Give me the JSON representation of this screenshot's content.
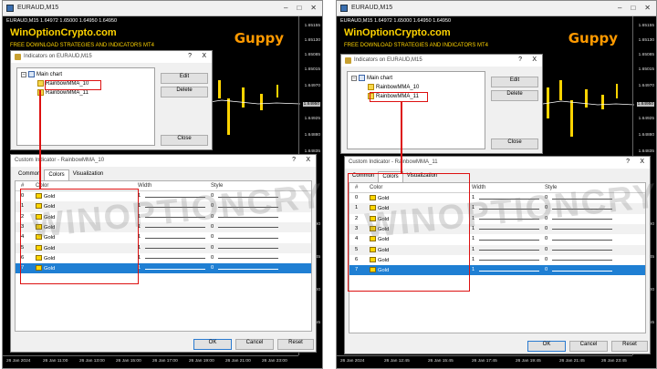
{
  "left": {
    "window_title": "EURAUD,M15",
    "symbol_line": "EURAUD,M15  1.64972  1.65000  1.64950  1.64950",
    "brand": "WinOptionCrypto.com",
    "subtitle": "FREE DOWNLOAD STRATEGIES AND INDICATORS MT4",
    "logo": "Guppy",
    "prices": [
      "1.65155",
      "1.65130",
      "1.65085",
      "1.65015",
      "1.64970",
      "1.64950",
      "1.64925",
      "1.64880",
      "1.64835",
      "1.64790",
      "1.64745",
      "1.64700",
      "1.64655"
    ],
    "times": [
      "26 Jan 2024",
      "26 Jan 11:00",
      "26 Jan 13:00",
      "26 Jan 15:00",
      "26 Jan 17:00",
      "26 Jan 19:00",
      "26 Jan 21:00",
      "26 Jan 23:00"
    ],
    "ind_dialog": {
      "title": "Indicators on EURAUD,M15",
      "help": "?",
      "close_x": "X",
      "main_chart": "Main chart",
      "items": [
        "RainbowMMA_10",
        "RainbowMMA_11"
      ],
      "edit": "Edit",
      "delete": "Delete",
      "close": "Close"
    },
    "custom_dialog": {
      "title": "Custom Indicator - RainbowMMA_10",
      "help": "?",
      "close_x": "X",
      "tabs": [
        "Common",
        "Colors",
        "Visualization"
      ],
      "columns": [
        "#",
        "Color",
        "Width",
        "Style"
      ],
      "rows": [
        {
          "n": "0",
          "color": "Gold",
          "width": "1",
          "style": "0"
        },
        {
          "n": "1",
          "color": "Gold",
          "width": "1",
          "style": "0"
        },
        {
          "n": "2",
          "color": "Gold",
          "width": "1",
          "style": "0"
        },
        {
          "n": "3",
          "color": "Gold",
          "width": "1",
          "style": "0"
        },
        {
          "n": "4",
          "color": "Gold",
          "width": "1",
          "style": "0"
        },
        {
          "n": "5",
          "color": "Gold",
          "width": "1",
          "style": "0"
        },
        {
          "n": "6",
          "color": "Gold",
          "width": "1",
          "style": "0"
        },
        {
          "n": "7",
          "color": "Gold",
          "width": "1",
          "style": "0"
        }
      ],
      "ok": "OK",
      "cancel": "Cancel",
      "reset": "Reset"
    }
  },
  "right": {
    "window_title": "EURAUD,M15",
    "symbol_line": "EURAUD,M15  1.64972  1.65000  1.64950  1.64950",
    "brand": "WinOptionCrypto.com",
    "subtitle": "FREE DOWNLOAD STRATEGIES AND INDICATORS MT4",
    "logo": "Guppy",
    "prices": [
      "1.65155",
      "1.65130",
      "1.65085",
      "1.65015",
      "1.64970",
      "1.64950",
      "1.64925",
      "1.64880",
      "1.64835",
      "1.64790",
      "1.64745",
      "1.64700",
      "1.64655"
    ],
    "times": [
      "26 Jan 2024",
      "26 Jan 12:45",
      "26 Jan 15:45",
      "26 Jan 17:45",
      "26 Jan 19:45",
      "26 Jan 21:45",
      "26 Jan 23:45"
    ],
    "ind_dialog": {
      "title": "Indicators on EURAUD,M15",
      "help": "?",
      "close_x": "X",
      "main_chart": "Main chart",
      "items": [
        "RainbowMMA_10",
        "RainbowMMA_11"
      ],
      "edit": "Edit",
      "delete": "Delete",
      "close": "Close"
    },
    "custom_dialog": {
      "title": "Custom Indicator - RainbowMMA_11",
      "help": "?",
      "close_x": "X",
      "tabs": [
        "Common",
        "Colors",
        "Visualization"
      ],
      "columns": [
        "#",
        "Color",
        "Width",
        "Style"
      ],
      "rows": [
        {
          "n": "0",
          "color": "Gold",
          "width": "1",
          "style": "0"
        },
        {
          "n": "1",
          "color": "Gold",
          "width": "1",
          "style": "0"
        },
        {
          "n": "2",
          "color": "Gold",
          "width": "1",
          "style": "0"
        },
        {
          "n": "3",
          "color": "Gold",
          "width": "1",
          "style": "0"
        },
        {
          "n": "4",
          "color": "Gold",
          "width": "1",
          "style": "0"
        },
        {
          "n": "5",
          "color": "Gold",
          "width": "1",
          "style": "0"
        },
        {
          "n": "6",
          "color": "Gold",
          "width": "1",
          "style": "0"
        },
        {
          "n": "7",
          "color": "Gold",
          "width": "1",
          "style": "0"
        }
      ],
      "ok": "OK",
      "cancel": "Cancel",
      "reset": "Reset"
    }
  },
  "watermark": "WINOPTIONCRYPTO.COM",
  "colors": {
    "brand": "#ffd400",
    "logo": "#ff9a00",
    "highlight": "#dd1111",
    "selected_row": "#1f7fd3"
  }
}
